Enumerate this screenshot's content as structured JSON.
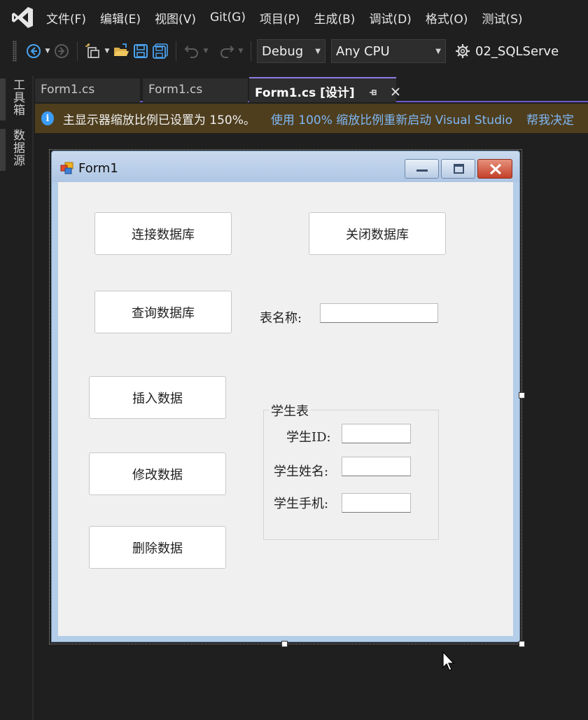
{
  "menu": {
    "items": [
      "文件(F)",
      "编辑(E)",
      "视图(V)",
      "Git(G)",
      "项目(P)",
      "生成(B)",
      "调试(D)",
      "格式(O)",
      "测试(S)"
    ]
  },
  "toolbar": {
    "config": "Debug",
    "platform": "Any CPU",
    "project": "02_SQLServe"
  },
  "side_panel": {
    "toolbox": "工具箱",
    "datasource": "数据源"
  },
  "tabs": {
    "tab1": "Form1.cs",
    "tab2": "Form1.cs",
    "active": "Form1.cs [设计]"
  },
  "infobar": {
    "message": "主显示器缩放比例已设置为 150%。",
    "link_restart": "使用 100% 缩放比例重新启动 Visual Studio",
    "link_help": "帮我决定"
  },
  "form": {
    "title": "Form1",
    "btn_connect": "连接数据库",
    "btn_close": "关闭数据库",
    "btn_query": "查询数据库",
    "label_table_name": "表名称:",
    "btn_insert": "插入数据",
    "btn_update": "修改数据",
    "btn_delete": "删除数据",
    "group_title": "学生表",
    "label_student_id": "学生ID:",
    "label_student_name": "学生姓名:",
    "label_student_phone": "学生手机:"
  },
  "colors": {
    "accent": "#6a5acd",
    "infobar_bg": "#4e3e1e",
    "link": "#7fb7f5"
  }
}
